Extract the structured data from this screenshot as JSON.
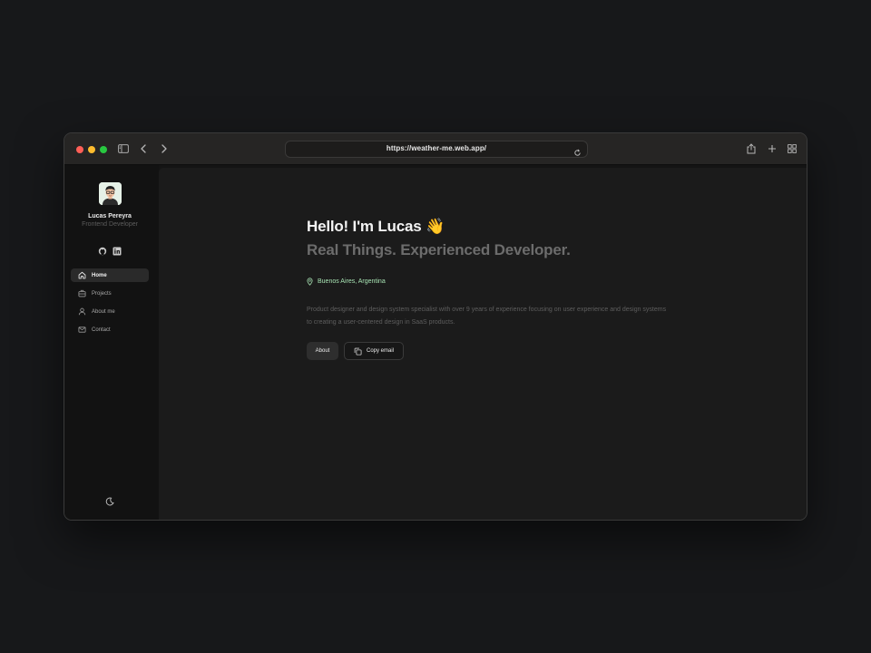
{
  "browser": {
    "url": "https://weather-me.web.app/",
    "traffic_colors": {
      "close": "#ff5f57",
      "minimize": "#febc2e",
      "zoom": "#28c840"
    },
    "icons": [
      "sidebar-toggle-icon",
      "back-icon",
      "forward-icon",
      "reload-icon",
      "share-icon",
      "new-tab-icon",
      "tab-overview-icon"
    ]
  },
  "profile": {
    "name": "Lucas Pereyra",
    "role": "Frontend Developer",
    "social": [
      "github-icon",
      "linkedin-icon"
    ]
  },
  "nav": {
    "items": [
      {
        "label": "Home",
        "icon": "home-icon",
        "active": true
      },
      {
        "label": "Projects",
        "icon": "briefcase-icon",
        "active": false
      },
      {
        "label": "About me",
        "icon": "user-icon",
        "active": false
      },
      {
        "label": "Contact",
        "icon": "mail-icon",
        "active": false
      }
    ]
  },
  "theme_toggle": {
    "icon": "moon-icon"
  },
  "hero": {
    "greeting": "Hello! I'm Lucas",
    "wave_emoji": "👋",
    "tagline": "Real Things. Experienced Developer.",
    "location": "Buenos Aires, Argentina",
    "description": "Product designer and design system specialist with over 9 years of experience focusing on user experience and design systems to creating a user-centered design in SaaS products.",
    "buttons": {
      "about": "About",
      "copy_email": "Copy email"
    }
  },
  "colors": {
    "background": "#17181a",
    "main": "#1b1b1b",
    "sidebar": "#121212",
    "location_accent": "#a7e3b3"
  }
}
